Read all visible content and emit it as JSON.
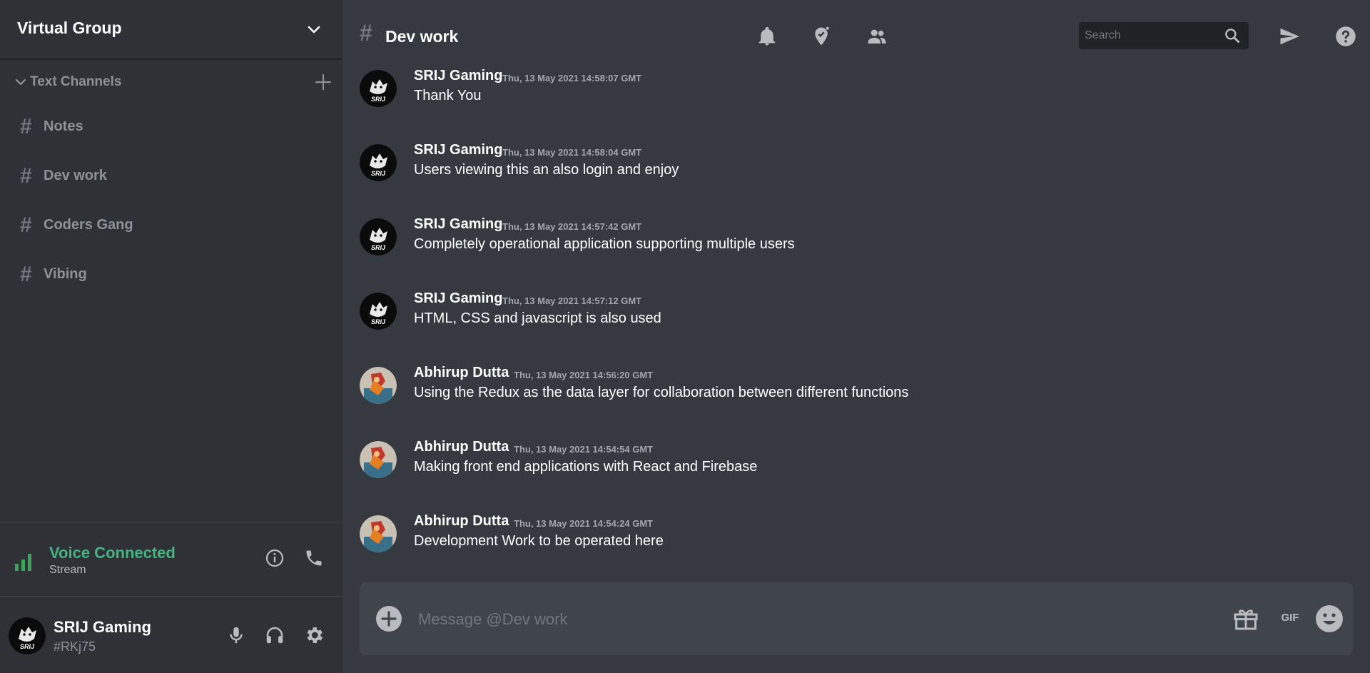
{
  "sidebar": {
    "server_name": "Virtual Group",
    "category_label": "Text Channels",
    "channels": [
      {
        "label": "Notes"
      },
      {
        "label": "Dev work"
      },
      {
        "label": "Coders Gang"
      },
      {
        "label": "Vibing"
      }
    ],
    "hash_glyph": "#",
    "voice": {
      "title": "Voice Connected",
      "subtitle": "Stream",
      "status_color": "#43b581"
    },
    "user": {
      "name": "SRIJ Gaming",
      "tag": "#RKj75",
      "avatar_text": "SRIJ"
    }
  },
  "header": {
    "hash_glyph": "#",
    "channel_title": "Dev work",
    "search_placeholder": "Search",
    "icons": [
      "bell-icon",
      "pin-icon",
      "members-icon",
      "search-icon",
      "send-icon",
      "help-icon"
    ]
  },
  "messages": [
    {
      "author": "SRIJ Gaming",
      "time": "Thu, 13 May 2021 14:58:07 GMT",
      "text": "Thank You",
      "avatar": "srij",
      "avatar_text": "SRIJ"
    },
    {
      "author": "SRIJ Gaming",
      "time": "Thu, 13 May 2021 14:58:04 GMT",
      "text": "Users viewing this an also login and enjoy",
      "avatar": "srij",
      "avatar_text": "SRIJ"
    },
    {
      "author": "SRIJ Gaming",
      "time": "Thu, 13 May 2021 14:57:42 GMT",
      "text": "Completely operational application supporting multiple users",
      "avatar": "srij",
      "avatar_text": "SRIJ"
    },
    {
      "author": "SRIJ Gaming",
      "time": "Thu, 13 May 2021 14:57:12 GMT",
      "text": "HTML, CSS and javascript is also used",
      "avatar": "srij",
      "avatar_text": "SRIJ"
    },
    {
      "author": "Abhirup Dutta",
      "time": "Thu, 13 May 2021 14:56:20 GMT",
      "text": "Using the Redux as the data layer for collaboration between different functions",
      "avatar": "abhirup"
    },
    {
      "author": "Abhirup Dutta",
      "time": "Thu, 13 May 2021 14:54:54 GMT",
      "text": "Making front end applications with React and Firebase",
      "avatar": "abhirup"
    },
    {
      "author": "Abhirup Dutta",
      "time": "Thu, 13 May 2021 14:54:24 GMT",
      "text": "Development Work to be operated here",
      "avatar": "abhirup"
    }
  ],
  "composer": {
    "placeholder": "Message @Dev work",
    "gif_label": "GIF",
    "icons": [
      "add-circle-icon",
      "gift-icon",
      "emoji-icon"
    ]
  },
  "colors": {
    "sidebar_bg": "#2f3136",
    "main_bg": "#36393f",
    "input_bg": "#40444b",
    "accent_green": "#43b581"
  }
}
